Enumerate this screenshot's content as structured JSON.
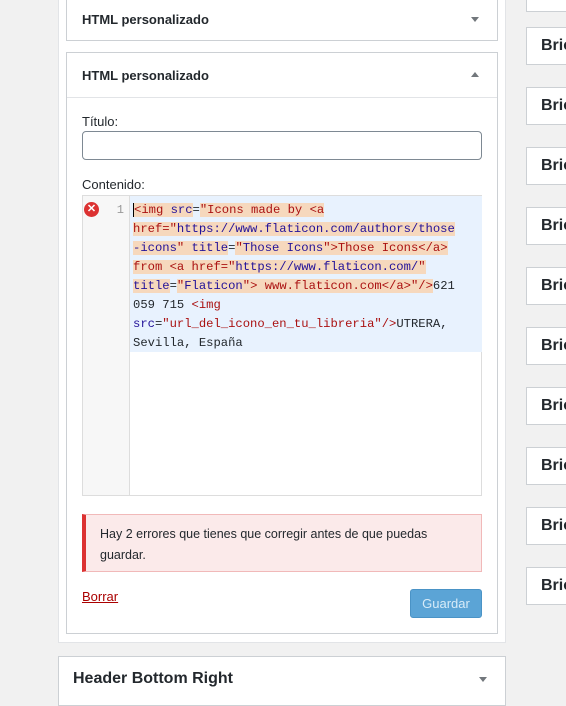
{
  "widgets": {
    "collapsed_title": "HTML personalizado",
    "open_title": "HTML personalizado",
    "title_label": "Título:",
    "content_label": "Contenido:",
    "line_number": "1",
    "code_lines": [
      [
        [
          "tag",
          "<img "
        ],
        [
          "att",
          "src"
        ],
        [
          "plain",
          "="
        ],
        [
          "str",
          "\"Icons made by <a "
        ]
      ],
      [
        [
          "str",
          "href=\""
        ],
        [
          "str2",
          "https://www.flaticon.com/authors/those"
        ]
      ],
      [
        [
          "str2",
          "-icons"
        ],
        [
          "str",
          "\" "
        ],
        [
          "att",
          "title"
        ],
        [
          "plain",
          "="
        ],
        [
          "str",
          "\""
        ],
        [
          "str2",
          "Those Icons"
        ],
        [
          "str",
          "\">Those Icons</a>"
        ]
      ],
      [
        [
          "str",
          "from <a href=\""
        ],
        [
          "str2",
          "https://www.flaticon.com/"
        ],
        [
          "str",
          "\""
        ]
      ],
      [
        [
          "att",
          "title"
        ],
        [
          "plain",
          "="
        ],
        [
          "str",
          "\""
        ],
        [
          "str2",
          "Flaticon"
        ],
        [
          "str",
          "\"> www.flaticon.com</a>\""
        ],
        [
          "tag",
          "/>"
        ],
        [
          "plain",
          "621"
        ]
      ],
      [
        [
          "plain",
          "059 715 "
        ],
        [
          "tag",
          "<img"
        ]
      ],
      [
        [
          "att",
          "src"
        ],
        [
          "plain",
          "="
        ],
        [
          "str",
          "\"url_del_icono_en_tu_libreria\""
        ],
        [
          "tag",
          "/>"
        ],
        [
          "plain",
          "UTRERA,"
        ]
      ],
      [
        [
          "plain",
          "Sevilla, España"
        ]
      ]
    ],
    "error_notice": "Hay 2 errores que tienes que corregir antes de que puedas guardar.",
    "delete_label": "Borrar",
    "save_label": "Guardar",
    "error_icon_glyph": "✕",
    "bottom_title": "Header Bottom Right"
  },
  "right_panel": {
    "items": [
      "Bric",
      "Bric",
      "Bric",
      "Bric",
      "Bric",
      "Bric",
      "Bric",
      "Bric",
      "Bric",
      "Bric"
    ]
  },
  "colors": {
    "error": "#dc3232",
    "primary_button_disabled": "#5ba4d6",
    "selection": "#e8f2fe",
    "match_highlight": "#f6d8bd"
  }
}
